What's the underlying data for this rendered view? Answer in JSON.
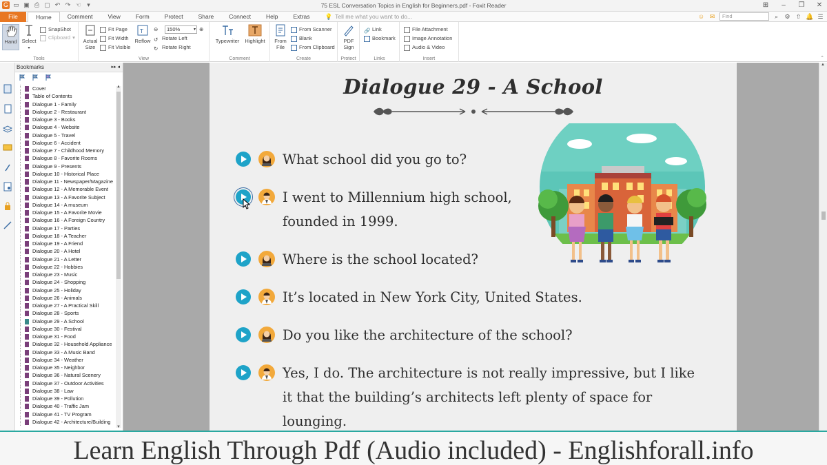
{
  "window": {
    "title": "75 ESL Conversation Topics in English for Beginners.pdf - Foxit Reader"
  },
  "menu": {
    "file_label": "File",
    "tabs": [
      "Home",
      "Comment",
      "View",
      "Form",
      "Protect",
      "Share",
      "Connect",
      "Help",
      "Extras"
    ],
    "active_tab": "Home",
    "tell_me": "Tell me what you want to do...",
    "find_placeholder": "Find"
  },
  "ribbon": {
    "tools": {
      "label": "Tools",
      "hand": "Hand",
      "select": "Select",
      "snapshot": "SnapShot",
      "clipboard": "Clipboard"
    },
    "view": {
      "label": "View",
      "actual_size": [
        "Actual",
        "Size"
      ],
      "fit_page": "Fit Page",
      "fit_width": "Fit Width",
      "fit_visible": "Fit Visible",
      "reflow": "Reflow",
      "zoom_value": "150%",
      "rotate_left": "Rotate Left",
      "rotate_right": "Rotate Right"
    },
    "comment": {
      "label": "Comment",
      "typewriter": "Typewriter",
      "highlight": "Highlight"
    },
    "create": {
      "label": "Create",
      "from_file": [
        "From",
        "File"
      ],
      "from_scanner": "From Scanner",
      "blank": "Blank",
      "from_clipboard": "From Clipboard"
    },
    "protect": {
      "label": "Protect",
      "pdf_sign": [
        "PDF",
        "Sign"
      ]
    },
    "links": {
      "label": "Links",
      "link": "Link",
      "bookmark": "Bookmark"
    },
    "insert": {
      "label": "Insert",
      "file_attachment": "File Attachment",
      "image_annotation": "Image Annotation",
      "audio_video": "Audio & Video"
    }
  },
  "bookmarks": {
    "title": "Bookmarks",
    "selected": "Dialogue 29 - A School",
    "items": [
      "Cover",
      "Table of Contents",
      "Dialogue 1 - Family",
      "Dialogue 2 - Restaurant",
      "Dialogue 3 - Books",
      "Dialogue 4 - Website",
      "Dialogue 5 - Travel",
      "Dialogue 6 - Accident",
      "Dialogue 7 - Childhood Memory",
      "Dialogue 8 - Favorite Rooms",
      "Dialogue 9 - Presents",
      "Dialogue 10 - Historical Place",
      "Dialogue 11 - Newspaper/Magazine",
      "Dialogue 12 - A Memorable Event",
      "Dialogue 13 - A Favorite Subject",
      "Dialogue 14 - A museum",
      "Dialogue 15 - A Favorite Movie",
      "Dialogue 16 - A Foreign Country",
      "Dialogue 17 - Parties",
      "Dialogue 18 - A Teacher",
      "Dialogue 19 - A Friend",
      "Dialogue 20 - A Hotel",
      "Dialogue 21 - A Letter",
      "Dialogue 22 - Hobbies",
      "Dialogue 23 - Music",
      "Dialogue 24 - Shopping",
      "Dialogue 25 - Holiday",
      "Dialogue 26 - Animals",
      "Dialogue 27 - A Practical Skill",
      "Dialogue 28 - Sports",
      "Dialogue 29 - A School",
      "Dialogue 30 - Festival",
      "Dialogue 31 - Food",
      "Dialogue 32 - Household Appliance",
      "Dialogue 33 - A Music Band",
      "Dialogue 34 - Weather",
      "Dialogue 35 - Neighbor",
      "Dialogue 36 - Natural Scenery",
      "Dialogue 37 - Outdoor Activities",
      "Dialogue 38 - Law",
      "Dialogue 39 - Pollution",
      "Dialogue 40 - Traffic Jam",
      "Dialogue 41 - TV Program",
      "Dialogue 42 - Architecture/Building"
    ]
  },
  "document": {
    "title": "Dialogue 29 - A School",
    "lines": [
      {
        "speaker": "female",
        "text": [
          "What school did you go to?"
        ]
      },
      {
        "speaker": "male",
        "text": [
          "I went to Millennium high school,",
          "founded in 1999."
        ]
      },
      {
        "speaker": "female",
        "text": [
          "Where is the school located?"
        ]
      },
      {
        "speaker": "male",
        "text": [
          "It’s located in New York City, United States."
        ]
      },
      {
        "speaker": "female",
        "text": [
          "Do you like the architecture of the school?"
        ]
      },
      {
        "speaker": "male",
        "text": [
          "Yes, I do. The architecture is not really impressive, but I like",
          "it that the building’s architects left plenty of space for",
          "lounging."
        ]
      }
    ]
  },
  "caption": "Learn English Through Pdf (Audio included) - Englishforall.info",
  "colors": {
    "accent_orange": "#e87722",
    "play_button": "#1ea3c8",
    "bookmark_flag": "#7a3f7a",
    "caption_border": "#2aa8a0"
  }
}
